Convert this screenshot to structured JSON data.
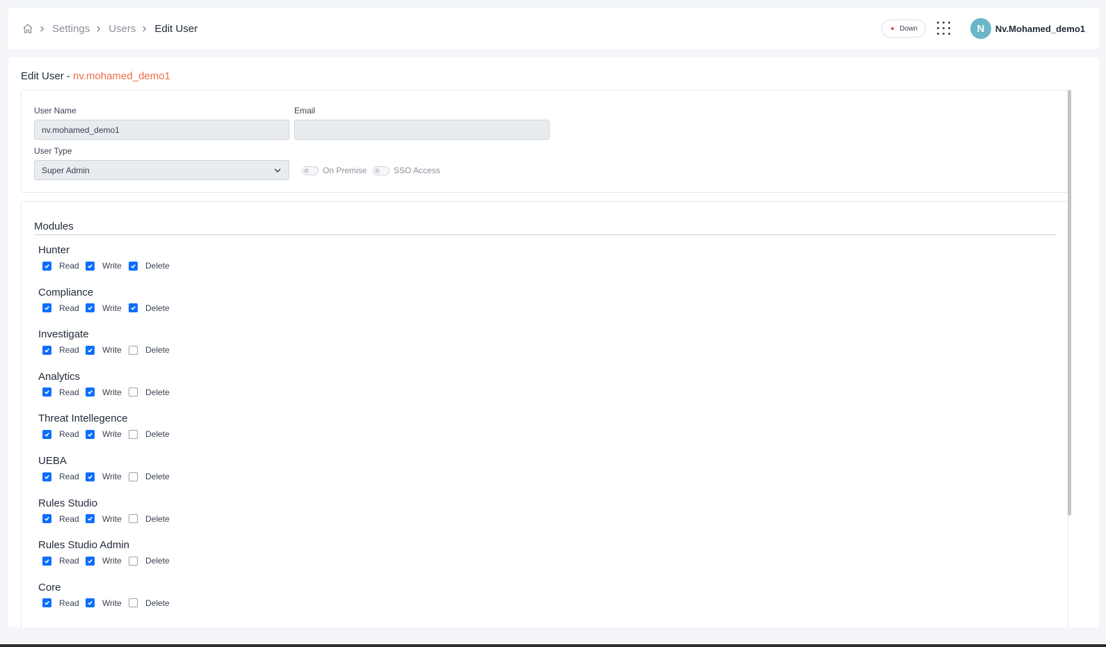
{
  "breadcrumb": {
    "items": [
      "Settings",
      "Users",
      "Edit User"
    ]
  },
  "header": {
    "status_label": "Down",
    "avatar_initial": "N",
    "username": "Nv.Mohamed_demo1"
  },
  "page": {
    "title_prefix": "Edit User - ",
    "title_user": "nv.mohamed_demo1"
  },
  "form": {
    "username_label": "User Name",
    "username_value": "nv.mohamed_demo1",
    "email_label": "Email",
    "email_value": "",
    "usertype_label": "User Type",
    "usertype_value": "Super Admin",
    "on_premise_label": "On Premise",
    "on_premise_enabled": false,
    "sso_label": "SSO Access",
    "sso_enabled": false
  },
  "modules": {
    "title": "Modules",
    "perm_labels": {
      "read": "Read",
      "write": "Write",
      "delete": "Delete"
    },
    "items": [
      {
        "name": "Hunter",
        "read": true,
        "write": true,
        "delete": true
      },
      {
        "name": "Compliance",
        "read": true,
        "write": true,
        "delete": true
      },
      {
        "name": "Investigate",
        "read": true,
        "write": true,
        "delete": false
      },
      {
        "name": "Analytics",
        "read": true,
        "write": true,
        "delete": false
      },
      {
        "name": "Threat Intellegence",
        "read": true,
        "write": true,
        "delete": false
      },
      {
        "name": "UEBA",
        "read": true,
        "write": true,
        "delete": false
      },
      {
        "name": "Rules Studio",
        "read": true,
        "write": true,
        "delete": false
      },
      {
        "name": "Rules Studio Admin",
        "read": true,
        "write": true,
        "delete": false
      },
      {
        "name": "Core",
        "read": true,
        "write": true,
        "delete": false
      }
    ]
  },
  "colors": {
    "accent": "#f26b4a",
    "checkbox": "#0d6efd",
    "avatar": "#69b7c8",
    "status_dot": "#e5484d"
  },
  "icons": [
    "home-icon",
    "chevron-right-icon",
    "apps-grid-icon",
    "chevron-down-icon",
    "checkmark-icon"
  ]
}
